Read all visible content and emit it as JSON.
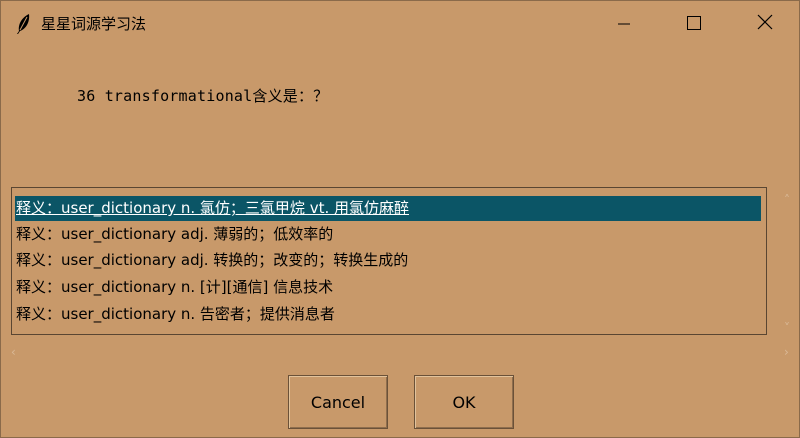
{
  "window": {
    "title": "星星词源学习法"
  },
  "question": "36 transformational含义是：？",
  "list": {
    "items": [
      {
        "text": "释义：user_dictionary n. 氯仿；三氯甲烷 vt. 用氯仿麻醉",
        "selected": true
      },
      {
        "text": "释义：user_dictionary adj.  薄弱的；低效率的",
        "selected": false
      },
      {
        "text": "释义：user_dictionary adj. 转换的；改变的；转换生成的",
        "selected": false
      },
      {
        "text": "释义：user_dictionary n. [计][通信]  信息技术",
        "selected": false
      },
      {
        "text": "释义：user_dictionary n.  告密者；提供消息者",
        "selected": false
      }
    ]
  },
  "buttons": {
    "cancel": "Cancel",
    "ok": "OK"
  },
  "icons": {
    "app": "feather-icon",
    "minimize": "minimize-icon",
    "maximize": "maximize-icon",
    "close": "close-icon"
  },
  "colors": {
    "window_bg": "#c8996a",
    "selection_bg": "#0b5566"
  }
}
